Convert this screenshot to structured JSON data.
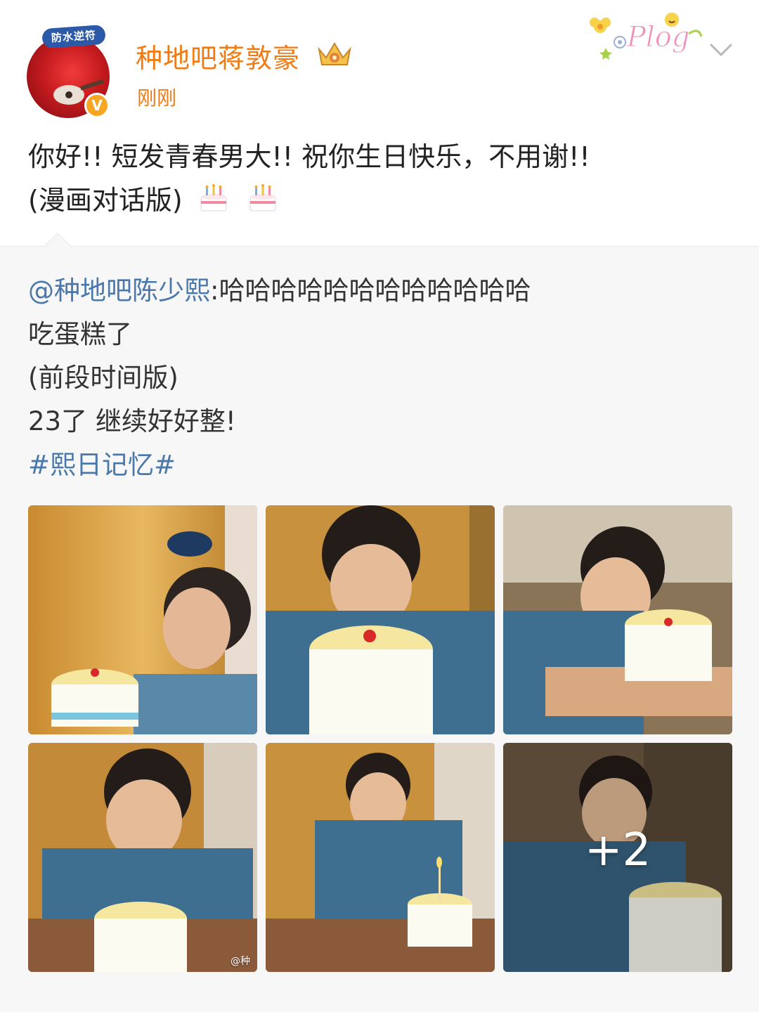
{
  "post": {
    "avatar_tag": "防水逆符",
    "username": "种地吧蒋敦豪",
    "timestamp": "刚刚",
    "sticker_text": "Plog",
    "line1": "你好!! 短发青春男大!! 祝你生日快乐，不用谢!!",
    "line2": "(漫画对话版)",
    "emoji": [
      "cake-emoji",
      "cake-emoji"
    ]
  },
  "repost": {
    "mention": "@种地吧陈少熙",
    "mention_suffix": ":哈哈哈哈哈哈哈哈哈哈哈哈",
    "line2": "吃蛋糕了",
    "line3": "(前段时间版)",
    "line4": "23了 继续好好整!",
    "hashtag": "#熙日记忆#",
    "photos_more": "+2",
    "photo_watermark": "@种"
  },
  "colors": {
    "username": "#f07a14",
    "link": "#4a78aa",
    "repost_bg": "#f7f7f7"
  }
}
